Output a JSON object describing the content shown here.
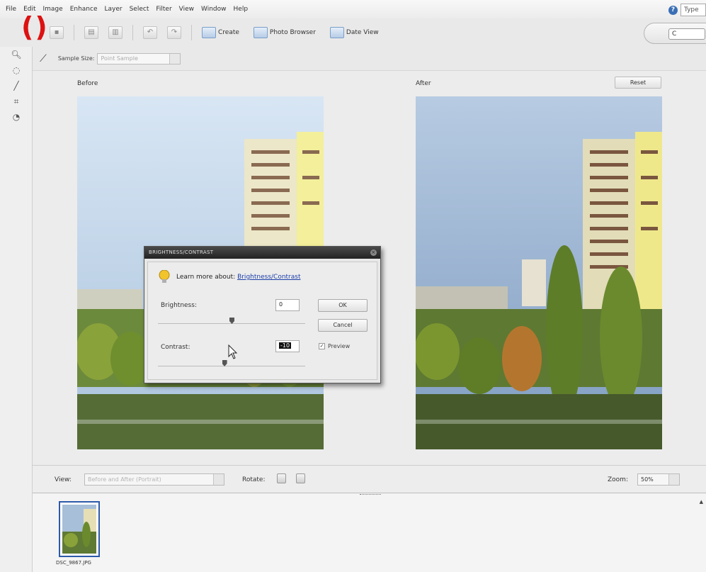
{
  "menu": [
    "File",
    "Edit",
    "Image",
    "Enhance",
    "Layer",
    "Select",
    "Filter",
    "View",
    "Window",
    "Help"
  ],
  "help_icon_label": "?",
  "type_box": "Type",
  "annotation_mark": "()",
  "toolbar": {
    "create": "Create",
    "photo_browser": "Photo Browser",
    "date_view": "Date View",
    "print_tab": "C"
  },
  "options": {
    "sample_size_label": "Sample Size:",
    "sample_size_value": "Point Sample"
  },
  "panes": {
    "before_label": "Before",
    "after_label": "After",
    "reset_label": "Reset"
  },
  "dialog": {
    "title": "BRIGHTNESS/CONTRAST",
    "learn_prefix": "Learn more about: ",
    "learn_link": "Brightness/Contrast",
    "brightness_label": "Brightness:",
    "brightness_value": "0",
    "contrast_label": "Contrast:",
    "contrast_value": "-10",
    "ok": "OK",
    "cancel": "Cancel",
    "preview": "Preview",
    "preview_checked": true,
    "brightness_level": 0,
    "contrast_level": -10
  },
  "bottom": {
    "view_label": "View:",
    "view_value": "Before and After (Portrait)",
    "rotate_label": "Rotate:",
    "zoom_label": "Zoom:",
    "zoom_value": "50%"
  },
  "bin": {
    "thumbnail_name": "DSC_9867.JPG"
  },
  "colors": {
    "accent": "#2d5aa8",
    "dialog_title_bg": "#2a2a2a",
    "annotation": "#d11111"
  }
}
